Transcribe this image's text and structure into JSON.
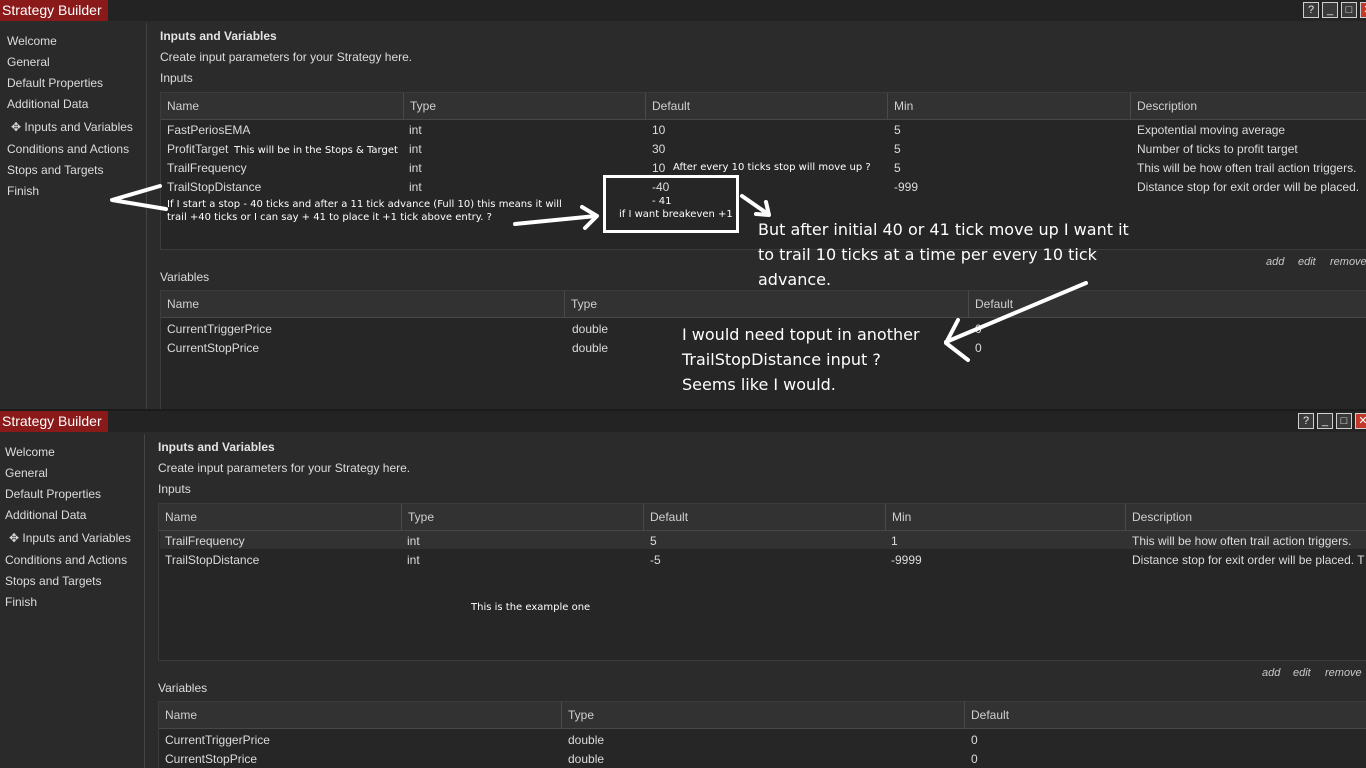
{
  "window_title": "Strategy Builder",
  "window_buttons": [
    "?",
    "_",
    "□",
    "✕"
  ],
  "nav": {
    "items": [
      "Welcome",
      "General",
      "Default Properties",
      "Additional Data",
      "Inputs and Variables",
      "Conditions and Actions",
      "Stops and Targets",
      "Finish"
    ],
    "active_marker": "✥"
  },
  "section_title": "Inputs and Variables",
  "section_desc": "Create input parameters for your Strategy here.",
  "inputs_label": "Inputs",
  "variables_label": "Variables",
  "inputs_columns": [
    "Name",
    "Type",
    "Default",
    "Min",
    "Description"
  ],
  "variables_columns": [
    "Name",
    "Type",
    "Default"
  ],
  "actions": [
    "add",
    "edit",
    "remove"
  ],
  "top": {
    "inputs_rows": [
      [
        "FastPeriosEMA",
        "int",
        "10",
        "5",
        "Expotential moving average"
      ],
      [
        "ProfitTarget",
        "int",
        "30",
        "5",
        "Number of ticks to profit target"
      ],
      [
        "TrailFrequency",
        "int",
        "10",
        "5",
        "This will be how often trail action triggers."
      ],
      [
        "TrailStopDistance",
        "int",
        "-40",
        "-999",
        "Distance stop for exit order will be placed."
      ]
    ],
    "variables_rows": [
      [
        "CurrentTriggerPrice",
        "double",
        "0"
      ],
      [
        "CurrentStopPrice",
        "double",
        "0"
      ]
    ]
  },
  "bottom": {
    "inputs_rows": [
      [
        "TrailFrequency",
        "int",
        "5",
        "1",
        "This will be how often trail action triggers."
      ],
      [
        "TrailStopDistance",
        "int",
        "-5",
        "-9999",
        "Distance stop for exit order will be placed. T"
      ]
    ],
    "variables_rows": [
      [
        "CurrentTriggerPrice",
        "double",
        "0"
      ],
      [
        "CurrentStopPrice",
        "double",
        "0"
      ]
    ]
  },
  "annotations": {
    "profit_note": "This will be in the Stops & Target",
    "trail_note": "After every  10 ticks stop will move up ?",
    "stop_note_1": "If I start a stop - 40 ticks and after a 11 tick advance (Full 10) this means it will",
    "stop_note_2": "trail +40 ticks or I can say + 41 to place it +1 tick above entry.   ?",
    "alt_value": "- 41",
    "breakeven_note": "if I want breakeven +1",
    "big_note_1": "But after initial 40 or 41 tick move up I want it to trail 10 ticks at a time per every 10 tick advance.",
    "big_note_2_a": "I would need toput in another",
    "big_note_2_b": "TrailStopDistance input ?",
    "big_note_2_c": "Seems like I would.",
    "example_note": "This is the example one"
  },
  "colors": {
    "title_bar": "#8a1a1a",
    "panel_bg": "#2b2b2b",
    "annotation": "#ffffff"
  }
}
